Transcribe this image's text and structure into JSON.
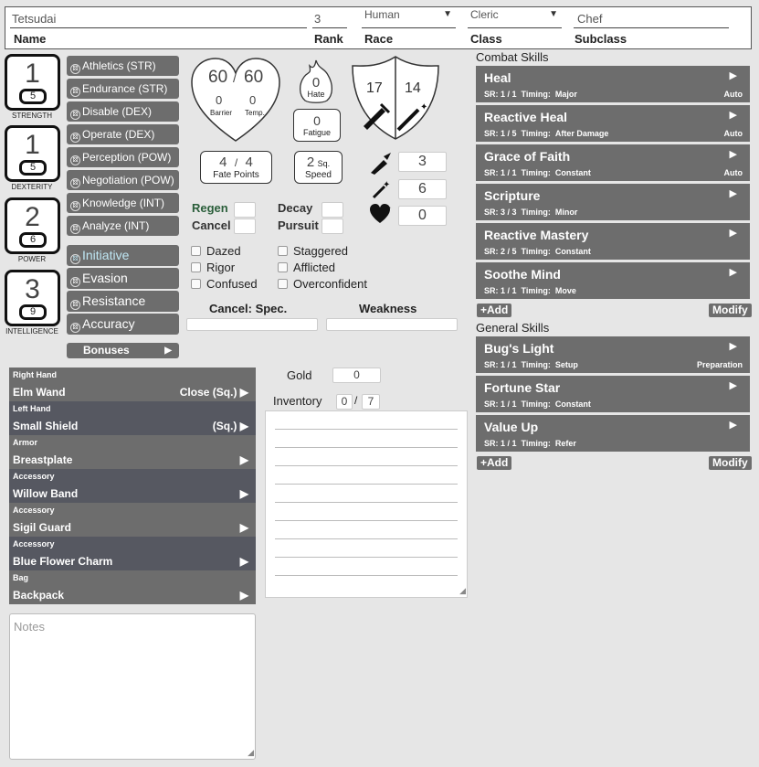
{
  "header": {
    "name_value": "Tetsudai",
    "name_label": "Name",
    "rank_value": "3",
    "rank_label": "Rank",
    "race_value": "Human",
    "race_label": "Race",
    "class_value": "Cleric",
    "class_label": "Class",
    "subclass_value": "Chef",
    "subclass_label": "Subclass"
  },
  "attributes": [
    {
      "value": "1",
      "mod": "5",
      "label": "STRENGTH"
    },
    {
      "value": "1",
      "mod": "5",
      "label": "DEXTERITY"
    },
    {
      "value": "2",
      "mod": "6",
      "label": "POWER"
    },
    {
      "value": "3",
      "mod": "9",
      "label": "INTELLIGENCE"
    }
  ],
  "skills": [
    "Athletics (STR)",
    "Endurance (STR)",
    "Disable (DEX)",
    "Operate (DEX)",
    "Perception (POW)",
    "Negotiation (POW)",
    "Knowledge (INT)",
    "Analyze (INT)"
  ],
  "combat_stats": [
    "Initiative",
    "Evasion",
    "Resistance",
    "Accuracy"
  ],
  "bonuses_label": "Bonuses",
  "hp": {
    "current": "60",
    "max": "60",
    "sep": "/",
    "barrier": "0",
    "barrier_label": "Barrier",
    "temp": "0",
    "temp_label": "Temp."
  },
  "hate": {
    "value": "0",
    "label": "Hate"
  },
  "fatigue": {
    "value": "0",
    "label": "Fatigue"
  },
  "fate": {
    "current": "4",
    "max": "4",
    "sep": "/",
    "label": "Fate Points"
  },
  "speed": {
    "value": "2",
    "unit": "Sq.",
    "label": "Speed"
  },
  "shield": {
    "left": "17",
    "right": "14"
  },
  "weapon_values": {
    "sword": "3",
    "wand": "6",
    "heart": "0"
  },
  "statuses": {
    "regen": "Regen",
    "decay": "Decay",
    "cancel": "Cancel",
    "pursuit": "Pursuit",
    "conditions": [
      "Dazed",
      "Staggered",
      "Rigor",
      "Afflicted",
      "Confused",
      "Overconfident"
    ]
  },
  "cancel_spec_label": "Cancel: Spec.",
  "weakness_label": "Weakness",
  "equipment": [
    {
      "slot": "Right Hand",
      "item": "Elm Wand",
      "range": "Close  (Sq.) ▶"
    },
    {
      "slot": "Left Hand",
      "item": "Small Shield",
      "range": "(Sq.) ▶"
    },
    {
      "slot": "Armor",
      "item": "Breastplate",
      "range": "▶"
    },
    {
      "slot": "Accessory",
      "item": "Willow Band",
      "range": "▶"
    },
    {
      "slot": "Accessory",
      "item": "Sigil Guard",
      "range": "▶"
    },
    {
      "slot": "Accessory",
      "item": "Blue Flower Charm",
      "range": "▶"
    },
    {
      "slot": "Bag",
      "item": "Backpack",
      "range": "▶"
    }
  ],
  "gold": {
    "label": "Gold",
    "value": "0"
  },
  "inventory": {
    "label": "Inventory",
    "used": "0",
    "sep": "/",
    "max": "7"
  },
  "notes_placeholder": "Notes",
  "combat_skills_title": "Combat Skills",
  "combat_skills": [
    {
      "name": "Heal",
      "sr": "SR: 1 / 1",
      "timing_label": "Timing:",
      "timing": "Major",
      "tag": "Auto"
    },
    {
      "name": "Reactive Heal",
      "sr": "SR: 1 / 5",
      "timing_label": "Timing:",
      "timing": "After Damage",
      "tag": "Auto"
    },
    {
      "name": "Grace of Faith",
      "sr": "SR: 1 / 1",
      "timing_label": "Timing:",
      "timing": "Constant",
      "tag": "Auto"
    },
    {
      "name": "Scripture",
      "sr": "SR: 3 / 3",
      "timing_label": "Timing:",
      "timing": "Minor",
      "tag": ""
    },
    {
      "name": "Reactive Mastery",
      "sr": "SR: 2 / 5",
      "timing_label": "Timing:",
      "timing": "Constant",
      "tag": ""
    },
    {
      "name": "Soothe Mind",
      "sr": "SR: 1 / 1",
      "timing_label": "Timing:",
      "timing": "Move",
      "tag": ""
    }
  ],
  "general_skills_title": "General Skills",
  "general_skills": [
    {
      "name": "Bug's Light",
      "sr": "SR: 1 / 1",
      "timing_label": "Timing:",
      "timing": "Setup",
      "tag": "Preparation"
    },
    {
      "name": "Fortune Star",
      "sr": "SR: 1 / 1",
      "timing_label": "Timing:",
      "timing": "Constant",
      "tag": ""
    },
    {
      "name": "Value Up",
      "sr": "SR: 1 / 1",
      "timing_label": "Timing:",
      "timing": "Refer",
      "tag": ""
    }
  ],
  "add_label": "+Add",
  "modify_label": "Modify"
}
